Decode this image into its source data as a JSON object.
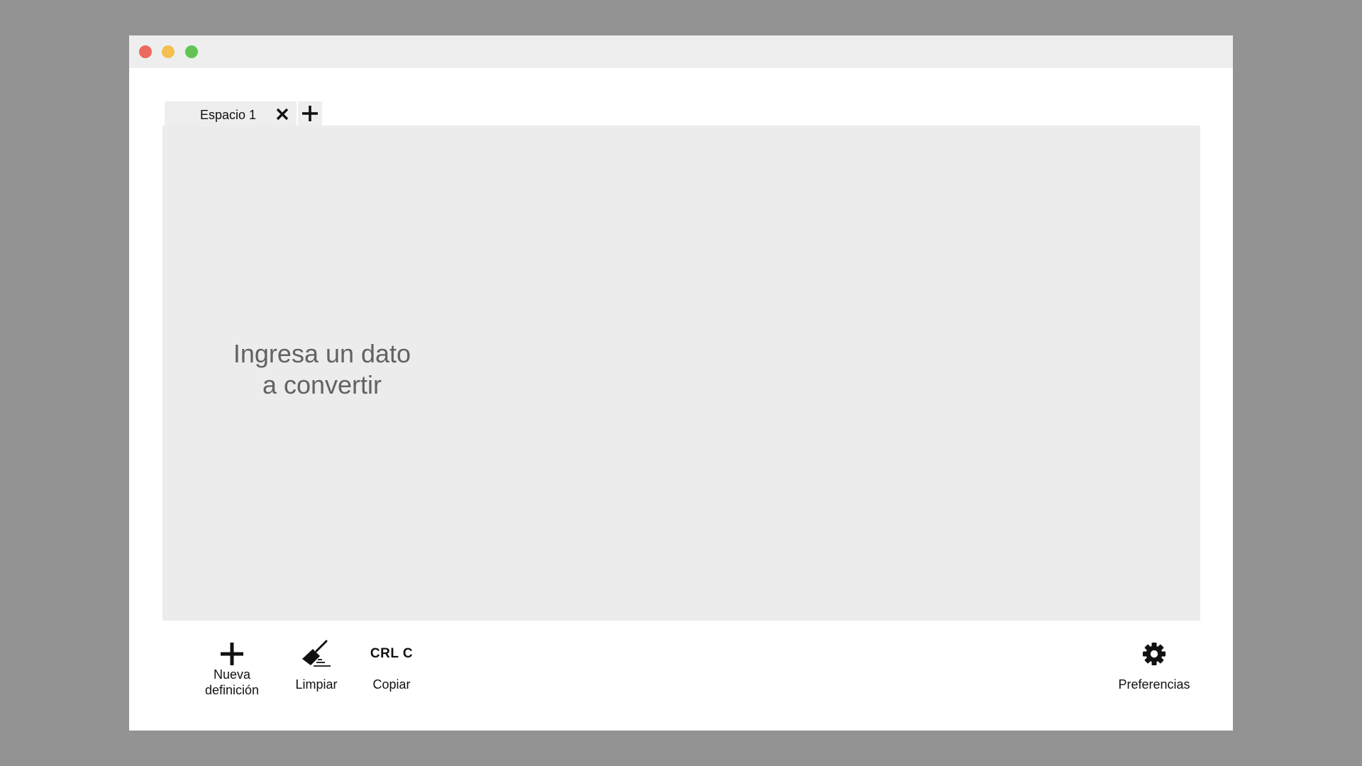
{
  "window": {
    "controls": [
      "close-icon",
      "minimize-icon",
      "maximize-icon"
    ],
    "colors": {
      "close": "#ec6a5e",
      "minimize": "#f4bf4f",
      "maximize": "#61c554"
    }
  },
  "tabs": [
    {
      "label": "Espacio 1",
      "close_icon": "close-icon"
    }
  ],
  "add_tab_icon": "plus-icon",
  "workspace": {
    "placeholder": "Ingresa un dato\na convertir"
  },
  "toolbar": {
    "new_definition": {
      "icon": "plus-icon",
      "label_line1": "Nueva",
      "label_line2": "definición"
    },
    "clean": {
      "icon": "broom-icon",
      "label": "Limpiar"
    },
    "copy": {
      "icon_text": "CRL C",
      "label": "Copiar"
    },
    "preferences": {
      "icon": "gear-icon",
      "label": "Preferencias"
    }
  }
}
